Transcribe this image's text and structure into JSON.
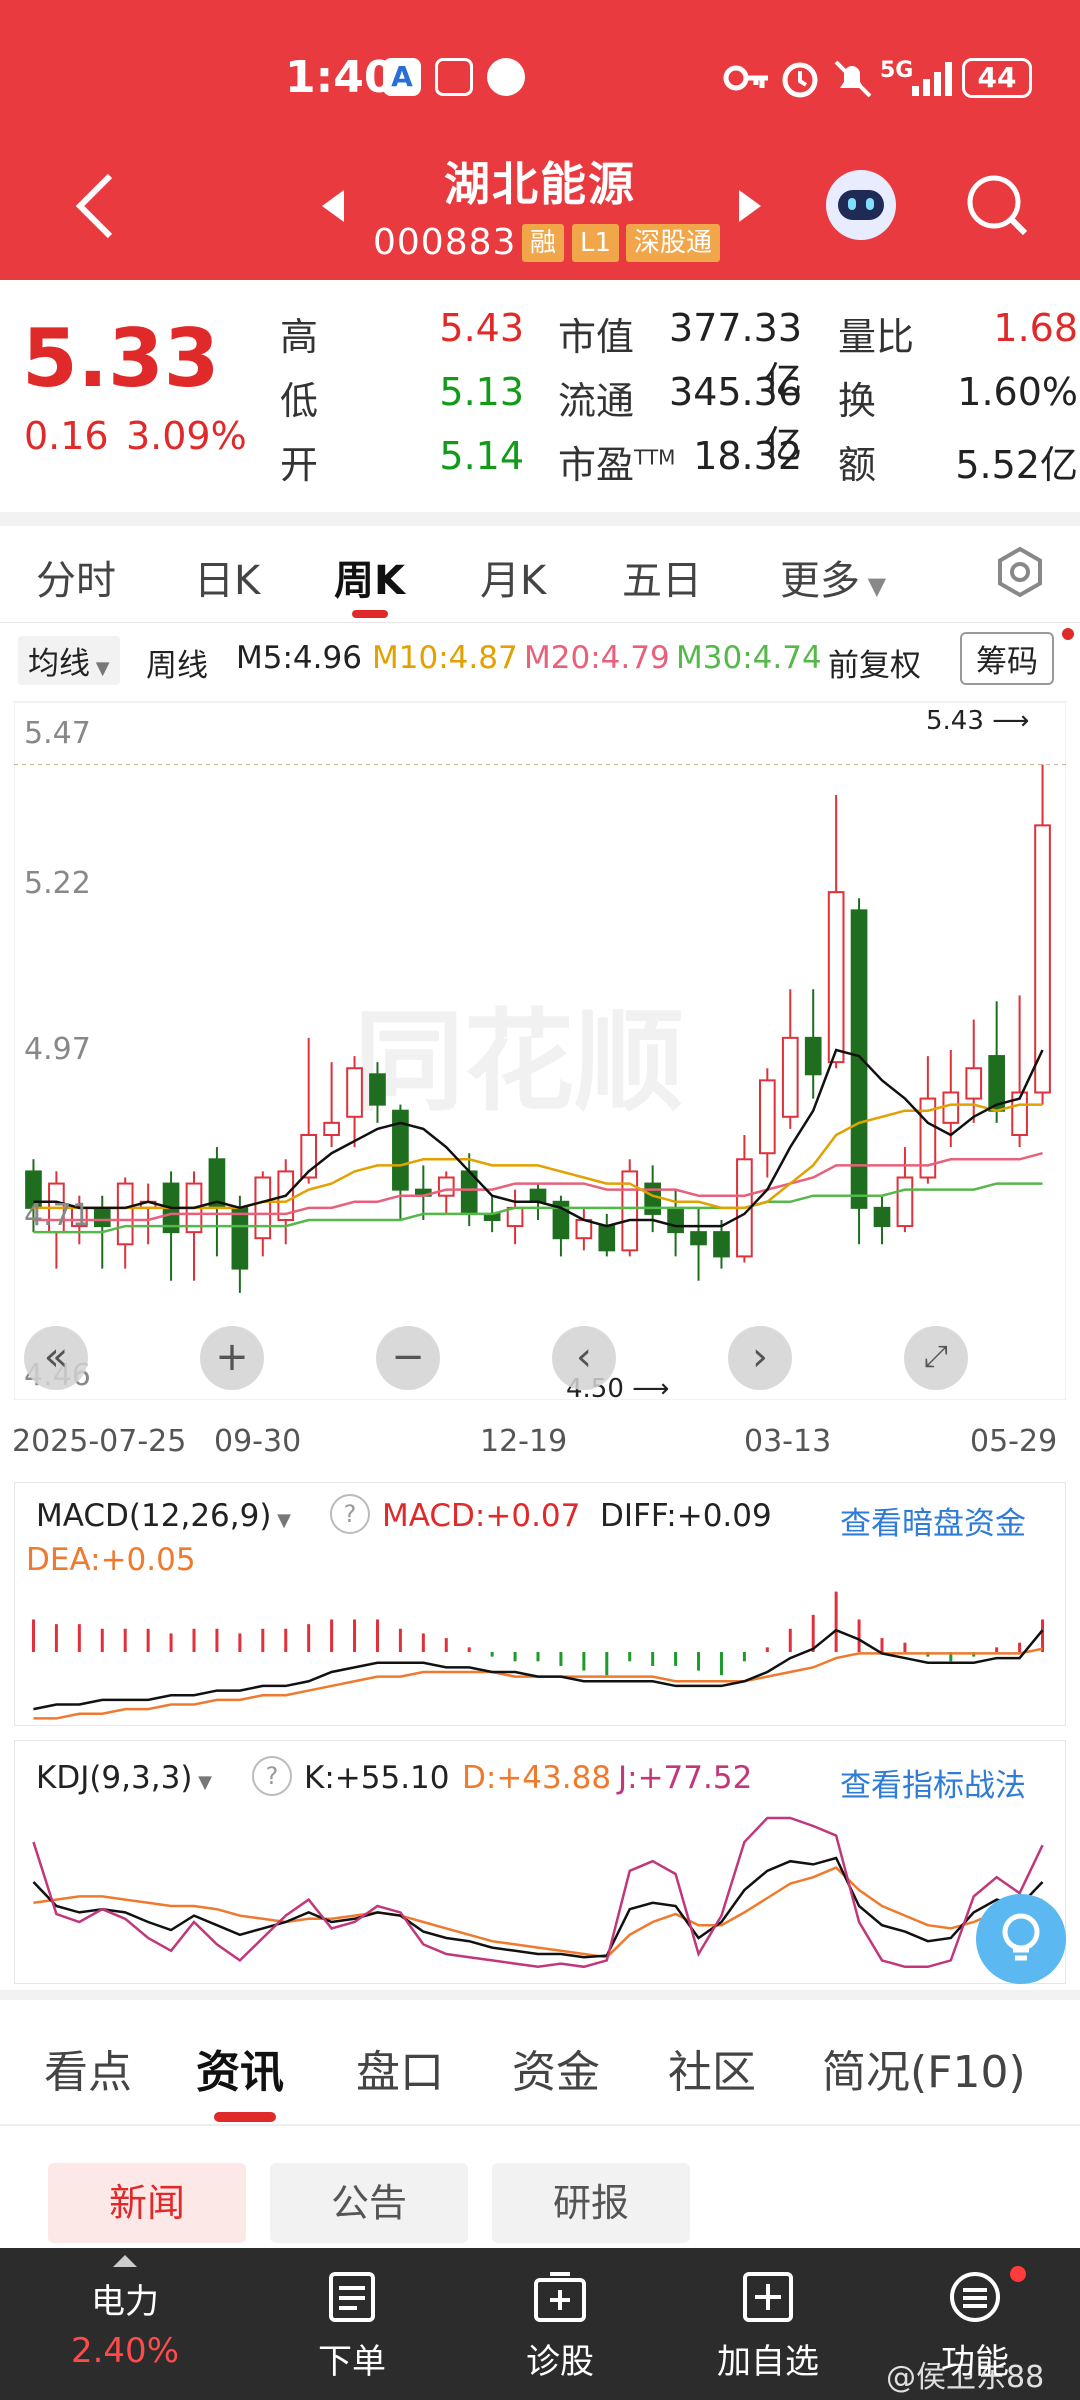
{
  "status": {
    "time": "1:40",
    "battery": "44",
    "network": "5G"
  },
  "header": {
    "name": "湖北能源",
    "code": "000883",
    "tags": [
      "融",
      "L1",
      "深股通"
    ]
  },
  "quote": {
    "price": "5.33",
    "change": "0.16",
    "pct": "3.09%",
    "high_label": "高",
    "high": "5.43",
    "low_label": "低",
    "low": "5.13",
    "open_label": "开",
    "open": "5.14",
    "mcap_label": "市值",
    "mcap": "377.33亿",
    "float_label": "流通",
    "float": "345.36亿",
    "pe_label": "市盈",
    "pe_sup": "TTM",
    "pe": "18.32",
    "vr_label": "量比",
    "vr": "1.68",
    "turn_label": "换",
    "turn": "1.60%",
    "amt_label": "额",
    "amt": "5.52亿"
  },
  "period_tabs": [
    "分时",
    "日K",
    "周K",
    "月K",
    "五日",
    "更多"
  ],
  "toolbar": {
    "ma_btn": "均线",
    "period": "周线",
    "m5": "M5:4.96",
    "m10": "M10:4.87",
    "m20": "M20:4.79",
    "m30": "M30:4.74",
    "adjust": "前复权",
    "chips_btn": "筹码"
  },
  "main_chart": {
    "yticks": [
      "5.47",
      "5.22",
      "4.97",
      "4.71",
      "4.46"
    ],
    "high_mark": "5.43",
    "low_mark": "4.50",
    "xticks": [
      "2025-07-25",
      "09-30",
      "12-19",
      "03-13",
      "05-29"
    ],
    "watermark": "同花顺"
  },
  "macd_panel": {
    "label": "MACD(12,26,9)",
    "macd": "MACD:+0.07",
    "diff": "DIFF:+0.09",
    "dea": "DEA:+0.05",
    "link": "查看暗盘资金"
  },
  "kdj_panel": {
    "label": "KDJ(9,3,3)",
    "k": "K:+55.10",
    "d": "D:+43.88",
    "j": "J:+77.52",
    "link": "查看指标战法"
  },
  "news_tabs": [
    "看点",
    "资讯",
    "盘口",
    "资金",
    "社区",
    "简况(F10)"
  ],
  "sub_tabs": [
    "新闻",
    "公告",
    "研报"
  ],
  "bottom_nav": {
    "sector": "电力",
    "sector_pct": "2.40%",
    "items": [
      "下单",
      "诊股",
      "加自选",
      "功能"
    ]
  },
  "watermark_user": "@侯卫东88",
  "chart_data": {
    "type": "candlestick",
    "ylim": [
      4.4,
      5.52
    ],
    "candles": [
      [
        4.76,
        4.7,
        4.78,
        4.66
      ],
      [
        4.66,
        4.74,
        4.76,
        4.6
      ],
      [
        4.67,
        4.7,
        4.72,
        4.64
      ],
      [
        4.7,
        4.67,
        4.72,
        4.6
      ],
      [
        4.64,
        4.74,
        4.75,
        4.6
      ],
      [
        4.7,
        4.71,
        4.74,
        4.64
      ],
      [
        4.74,
        4.66,
        4.76,
        4.58
      ],
      [
        4.66,
        4.74,
        4.76,
        4.58
      ],
      [
        4.78,
        4.7,
        4.8,
        4.62
      ],
      [
        4.7,
        4.6,
        4.72,
        4.56
      ],
      [
        4.65,
        4.75,
        4.76,
        4.62
      ],
      [
        4.68,
        4.76,
        4.78,
        4.64
      ],
      [
        4.75,
        4.82,
        4.98,
        4.74
      ],
      [
        4.82,
        4.84,
        4.94,
        4.8
      ],
      [
        4.85,
        4.93,
        4.95,
        4.8
      ],
      [
        4.92,
        4.87,
        4.94,
        4.84
      ],
      [
        4.86,
        4.73,
        4.87,
        4.68
      ],
      [
        4.73,
        4.72,
        4.77,
        4.68
      ],
      [
        4.72,
        4.75,
        4.76,
        4.69
      ],
      [
        4.76,
        4.69,
        4.79,
        4.67
      ],
      [
        4.69,
        4.68,
        4.72,
        4.66
      ],
      [
        4.67,
        4.7,
        4.73,
        4.64
      ],
      [
        4.73,
        4.71,
        4.74,
        4.68
      ],
      [
        4.71,
        4.65,
        4.72,
        4.62
      ],
      [
        4.65,
        4.68,
        4.7,
        4.63
      ],
      [
        4.67,
        4.63,
        4.69,
        4.62
      ],
      [
        4.63,
        4.76,
        4.78,
        4.62
      ],
      [
        4.74,
        4.69,
        4.77,
        4.66
      ],
      [
        4.7,
        4.66,
        4.73,
        4.62
      ],
      [
        4.66,
        4.64,
        4.7,
        4.58
      ],
      [
        4.66,
        4.62,
        4.68,
        4.6
      ],
      [
        4.62,
        4.78,
        4.82,
        4.61
      ],
      [
        4.79,
        4.91,
        4.93,
        4.75
      ],
      [
        4.85,
        4.98,
        5.06,
        4.83
      ],
      [
        4.98,
        4.92,
        5.06,
        4.88
      ],
      [
        4.94,
        5.22,
        5.38,
        4.93
      ],
      [
        5.19,
        4.7,
        5.21,
        4.64
      ],
      [
        4.7,
        4.67,
        4.72,
        4.64
      ],
      [
        4.67,
        4.75,
        4.8,
        4.66
      ],
      [
        4.75,
        4.88,
        4.95,
        4.74
      ],
      [
        4.84,
        4.89,
        4.96,
        4.8
      ],
      [
        4.88,
        4.93,
        5.01,
        4.84
      ],
      [
        4.95,
        4.86,
        5.04,
        4.84
      ],
      [
        4.82,
        4.89,
        5.05,
        4.8
      ],
      [
        4.89,
        5.33,
        5.43,
        4.87
      ]
    ],
    "ma5": [
      4.71,
      4.71,
      4.7,
      4.7,
      4.7,
      4.71,
      4.7,
      4.7,
      4.71,
      4.7,
      4.71,
      4.72,
      4.76,
      4.79,
      4.81,
      4.83,
      4.84,
      4.83,
      4.8,
      4.76,
      4.72,
      4.71,
      4.71,
      4.7,
      4.68,
      4.67,
      4.68,
      4.68,
      4.67,
      4.67,
      4.67,
      4.69,
      4.73,
      4.8,
      4.86,
      4.96,
      4.95,
      4.91,
      4.88,
      4.84,
      4.82,
      4.85,
      4.87,
      4.88,
      4.96
    ],
    "ma10": [
      4.7,
      4.7,
      4.7,
      4.7,
      4.7,
      4.7,
      4.7,
      4.7,
      4.7,
      4.7,
      4.71,
      4.71,
      4.73,
      4.74,
      4.76,
      4.77,
      4.77,
      4.78,
      4.78,
      4.78,
      4.77,
      4.77,
      4.77,
      4.76,
      4.75,
      4.74,
      4.74,
      4.72,
      4.71,
      4.71,
      4.7,
      4.7,
      4.71,
      4.74,
      4.77,
      4.82,
      4.84,
      4.85,
      4.86,
      4.86,
      4.87,
      4.87,
      4.86,
      4.87,
      4.87
    ],
    "ma20": [
      4.68,
      4.68,
      4.68,
      4.68,
      4.68,
      4.68,
      4.69,
      4.69,
      4.69,
      4.69,
      4.69,
      4.69,
      4.7,
      4.7,
      4.71,
      4.71,
      4.72,
      4.72,
      4.73,
      4.73,
      4.73,
      4.74,
      4.74,
      4.74,
      4.74,
      4.73,
      4.73,
      4.73,
      4.73,
      4.72,
      4.72,
      4.72,
      4.73,
      4.74,
      4.75,
      4.77,
      4.77,
      4.77,
      4.77,
      4.77,
      4.78,
      4.78,
      4.78,
      4.78,
      4.79
    ],
    "ma30": [
      4.66,
      4.66,
      4.66,
      4.66,
      4.67,
      4.67,
      4.67,
      4.67,
      4.67,
      4.67,
      4.67,
      4.67,
      4.68,
      4.68,
      4.68,
      4.68,
      4.68,
      4.69,
      4.69,
      4.69,
      4.69,
      4.7,
      4.7,
      4.7,
      4.7,
      4.7,
      4.7,
      4.7,
      4.7,
      4.7,
      4.7,
      4.7,
      4.71,
      4.71,
      4.72,
      4.72,
      4.72,
      4.72,
      4.73,
      4.73,
      4.73,
      4.73,
      4.74,
      4.74,
      4.74
    ],
    "macd_hist": [
      0.07,
      0.06,
      0.06,
      0.05,
      0.05,
      0.05,
      0.04,
      0.05,
      0.05,
      0.04,
      0.05,
      0.05,
      0.06,
      0.07,
      0.07,
      0.07,
      0.05,
      0.04,
      0.03,
      0.01,
      -0.01,
      -0.02,
      -0.02,
      -0.03,
      -0.04,
      -0.05,
      -0.02,
      -0.03,
      -0.03,
      -0.04,
      -0.05,
      -0.02,
      0.01,
      0.05,
      0.08,
      0.13,
      0.07,
      0.03,
      0.02,
      -0.01,
      -0.02,
      -0.01,
      0.01,
      0.02,
      0.07
    ],
    "diff": [
      -0.08,
      -0.07,
      -0.07,
      -0.06,
      -0.06,
      -0.06,
      -0.05,
      -0.05,
      -0.04,
      -0.04,
      -0.03,
      -0.03,
      -0.02,
      0.0,
      0.01,
      0.02,
      0.02,
      0.02,
      0.01,
      0.01,
      0.0,
      0.0,
      -0.01,
      -0.01,
      -0.02,
      -0.02,
      -0.02,
      -0.02,
      -0.03,
      -0.03,
      -0.03,
      -0.02,
      0.0,
      0.03,
      0.05,
      0.09,
      0.07,
      0.04,
      0.03,
      0.02,
      0.02,
      0.02,
      0.03,
      0.03,
      0.09
    ],
    "dea": [
      -0.1,
      -0.1,
      -0.09,
      -0.09,
      -0.08,
      -0.08,
      -0.07,
      -0.07,
      -0.06,
      -0.06,
      -0.05,
      -0.05,
      -0.04,
      -0.03,
      -0.02,
      -0.01,
      -0.01,
      0.0,
      0.0,
      0.0,
      0.0,
      -0.01,
      -0.01,
      -0.01,
      -0.01,
      -0.01,
      -0.01,
      -0.01,
      -0.02,
      -0.02,
      -0.02,
      -0.02,
      -0.01,
      0.0,
      0.01,
      0.03,
      0.04,
      0.04,
      0.04,
      0.04,
      0.04,
      0.04,
      0.04,
      0.04,
      0.05
    ],
    "k": [
      55,
      40,
      36,
      38,
      36,
      30,
      25,
      34,
      28,
      22,
      26,
      30,
      36,
      30,
      32,
      36,
      34,
      24,
      20,
      18,
      14,
      12,
      10,
      10,
      8,
      9,
      38,
      42,
      40,
      20,
      30,
      50,
      62,
      68,
      66,
      70,
      40,
      28,
      24,
      18,
      20,
      36,
      44,
      40,
      55
    ],
    "d": [
      42,
      44,
      46,
      46,
      44,
      42,
      40,
      40,
      38,
      34,
      32,
      30,
      32,
      32,
      34,
      36,
      34,
      30,
      26,
      22,
      18,
      16,
      14,
      12,
      10,
      8,
      22,
      30,
      35,
      28,
      28,
      36,
      45,
      54,
      58,
      64,
      50,
      40,
      34,
      28,
      26,
      30,
      36,
      38,
      44
    ],
    "j": [
      80,
      35,
      30,
      38,
      32,
      20,
      12,
      30,
      16,
      6,
      20,
      34,
      44,
      26,
      30,
      40,
      36,
      16,
      10,
      8,
      6,
      4,
      2,
      4,
      2,
      6,
      62,
      68,
      60,
      10,
      34,
      80,
      95,
      95,
      90,
      84,
      30,
      6,
      2,
      2,
      6,
      46,
      58,
      48,
      78
    ]
  }
}
